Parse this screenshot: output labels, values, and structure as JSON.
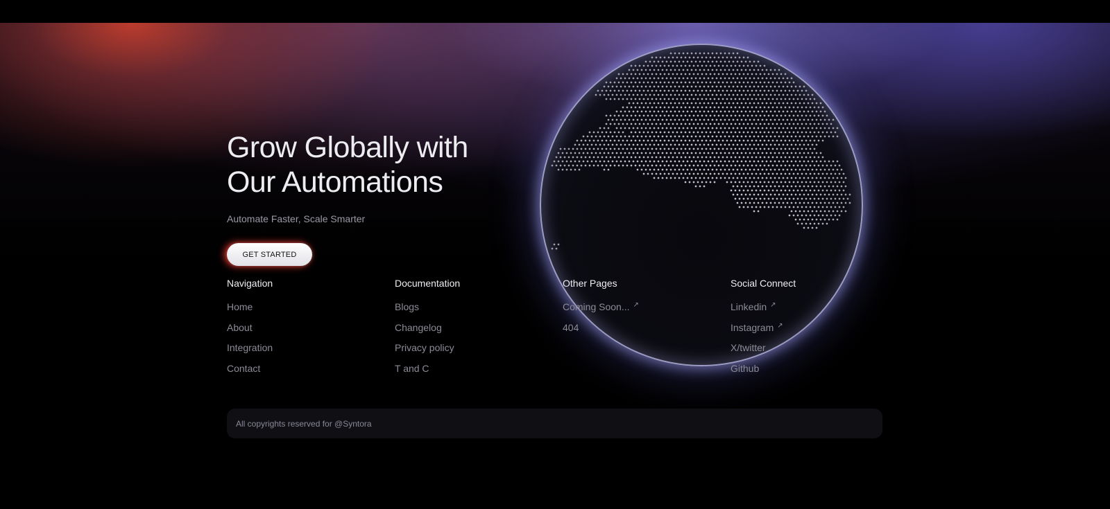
{
  "hero": {
    "title_line1": "Grow Globally with",
    "title_line2": "Our Automations",
    "subtitle": "Automate Faster, Scale Smarter",
    "cta_label": "GET STARTED"
  },
  "columns": [
    {
      "heading": "Navigation",
      "links": [
        {
          "label": "Home"
        },
        {
          "label": "About"
        },
        {
          "label": "Integration"
        },
        {
          "label": "Contact"
        }
      ]
    },
    {
      "heading": "Documentation",
      "links": [
        {
          "label": "Blogs"
        },
        {
          "label": "Changelog"
        },
        {
          "label": "Privacy policy"
        },
        {
          "label": "T and C"
        }
      ]
    },
    {
      "heading": "Other Pages",
      "links": [
        {
          "label": "Coming Soon...",
          "icon": "arrow-up-right-icon"
        },
        {
          "label": "404"
        }
      ]
    },
    {
      "heading": "Social Connect",
      "links": [
        {
          "label": "Linkedin",
          "icon": "arrow-up-right-icon"
        },
        {
          "label": "Instagram",
          "icon": "arrow-up-right-icon"
        },
        {
          "label": "X/twitter"
        },
        {
          "label": "Github"
        }
      ]
    }
  ],
  "footer": {
    "copyright": "All copyrights reserved for @Syntora"
  },
  "icons": {
    "external_link": "arrow-up-right-icon",
    "globe": "globe-icon"
  },
  "colors": {
    "background": "#000000",
    "glow_red": "#c43e2e",
    "glow_violet": "#7a6ed0",
    "globe_rim": "#cdcdff",
    "button_glow": "#eb372d"
  }
}
